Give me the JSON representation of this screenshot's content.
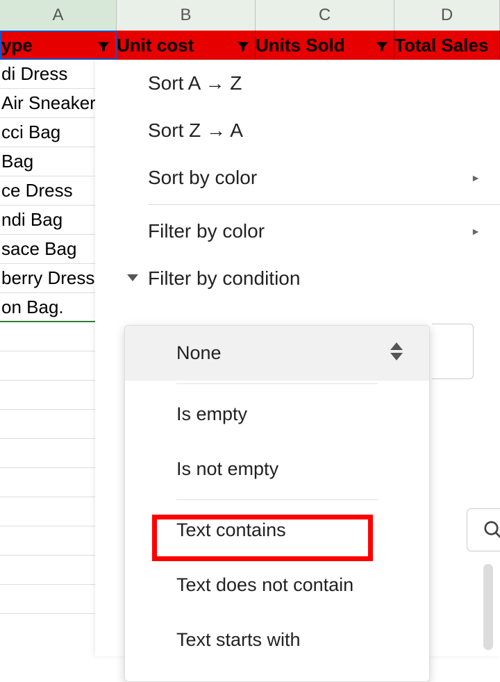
{
  "columns": {
    "a_letter": "A",
    "b_letter": "B",
    "c_letter": "C",
    "d_letter": "D",
    "a_header": "ype",
    "b_header": "Unit cost",
    "c_header": "Units Sold",
    "d_header": "Total Sales"
  },
  "rows": [
    "di Dress",
    "Air Sneaker",
    "cci Bag",
    " Bag",
    "ce Dress",
    "ndi Bag",
    "sace Bag",
    "berry Dress",
    "on Bag."
  ],
  "menu": {
    "sort_az": "Sort A → Z",
    "sort_za": "Sort Z → A",
    "sort_color": "Sort by color",
    "filter_color": "Filter by color",
    "filter_condition": "Filter by condition"
  },
  "conditions": {
    "none": "None",
    "is_empty": "Is empty",
    "is_not_empty": "Is not empty",
    "text_contains": "Text contains",
    "text_not_contain": "Text does not contain",
    "text_starts": "Text starts with"
  }
}
